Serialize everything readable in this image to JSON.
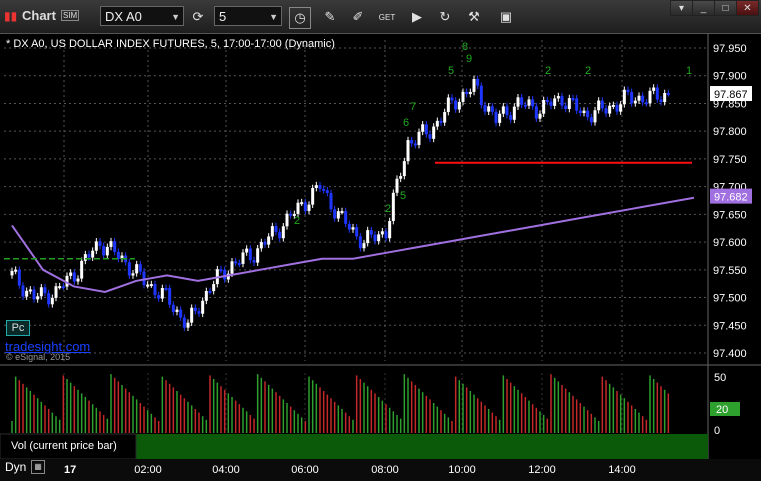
{
  "app": {
    "title": "Chart",
    "badge": "SIM"
  },
  "toolbar": {
    "symbol": "DX A0",
    "interval": "5",
    "icons": [
      "link-cycle-icon",
      "clock-icon",
      "pencil-icon",
      "draw-icon",
      "get-data-icon",
      "play-icon",
      "refresh-icon",
      "tools-icon",
      "browser-icon"
    ]
  },
  "chart": {
    "header": "* DX A0, US DOLLAR INDEX FUTURES, 5, 17:00-17:00 (Dynamic)",
    "watermark": "tradesight.com",
    "copyright": "© eSignal, 2015",
    "pc_label": "Pc",
    "last_price": "97.867",
    "ma_value": "97.682",
    "price_ticks": [
      "97.950",
      "97.900",
      "97.850",
      "97.800",
      "97.750",
      "97.700",
      "97.650",
      "97.600",
      "97.550",
      "97.500",
      "97.450",
      "97.400"
    ],
    "vol_ticks": [
      "50",
      "0"
    ],
    "vol_badge": "20",
    "vol_label": "Vol (current price bar)",
    "time_mode": "Dyn",
    "time_ticks": [
      "17",
      "02:00",
      "04:00",
      "06:00",
      "08:00",
      "10:00",
      "12:00",
      "14:00"
    ],
    "colors": {
      "up_bar": "#ffffff",
      "down_bar": "#1f36ff",
      "ma_line": "#a070e0",
      "resistance": "#ff1010",
      "dashed_level": "#22a022",
      "setup_digits": "#1fa81f",
      "vol_up": "#2ea02e",
      "vol_down": "#c42828",
      "vol_bg": "#0a5a0a"
    }
  },
  "chart_data": {
    "type": "line",
    "title": "* DX A0, US DOLLAR INDEX FUTURES, 5, 17:00-17:00 (Dynamic)",
    "x": [
      "17",
      "02:00",
      "04:00",
      "06:00",
      "08:00",
      "10:00",
      "12:00",
      "14:00"
    ],
    "ylim": [
      97.4,
      97.95
    ],
    "series": [
      {
        "values": [
          97.54,
          97.5,
          97.51,
          97.55,
          97.6,
          97.57,
          97.53,
          97.5,
          97.45,
          97.52,
          97.56,
          97.58,
          97.62,
          97.66,
          97.7,
          97.64,
          97.6,
          97.62,
          97.78,
          97.8,
          97.85,
          97.88,
          97.82,
          97.85,
          97.84,
          97.86,
          97.83,
          97.84,
          97.86,
          97.86,
          97.87
        ]
      },
      {
        "values": [
          97.63,
          97.55,
          97.52,
          97.51,
          97.53,
          97.54,
          97.53,
          97.54,
          97.55,
          97.56,
          97.57,
          97.57,
          97.58,
          97.59,
          97.6,
          97.61,
          97.62,
          97.63,
          97.64,
          97.65,
          97.66,
          97.67,
          97.68
        ]
      }
    ],
    "levels": [
      97.743,
      97.57
    ],
    "volume": {
      "ylim": [
        0,
        50
      ],
      "last": 20
    }
  }
}
